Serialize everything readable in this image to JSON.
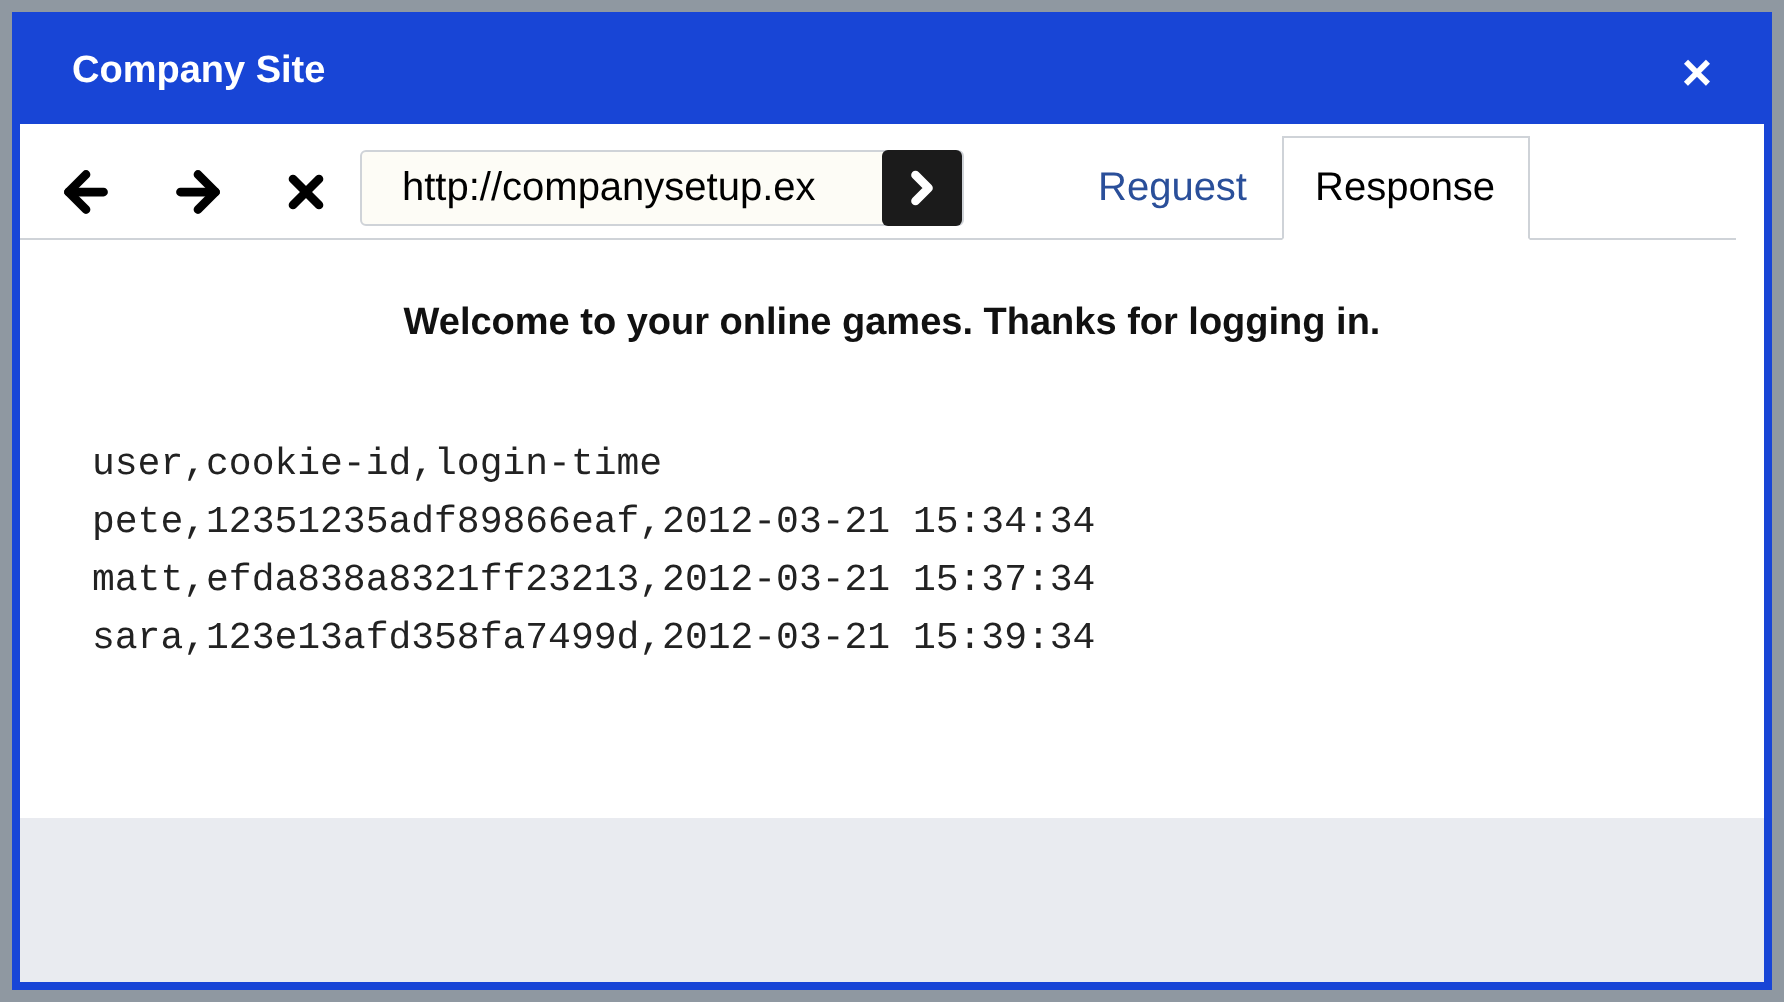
{
  "window": {
    "title": "Company Site",
    "close": "×"
  },
  "toolbar": {
    "address": {
      "value": "http://companysetup.ex"
    }
  },
  "tabs": [
    {
      "label": "Reguest",
      "selected": false
    },
    {
      "label": "Response",
      "selected": true
    }
  ],
  "content": {
    "heading": "Welcome to your online games. Thanks for logging in.",
    "lines": [
      "user,cookie-id,login-time",
      "pete,12351235adf89866eaf,2012-03-21 15:34:34",
      "matt,efda838a8321ff23213,2012-03-21 15:37:34",
      "sara,123e13afd358fa7499d,2012-03-21 15:39:34"
    ]
  }
}
